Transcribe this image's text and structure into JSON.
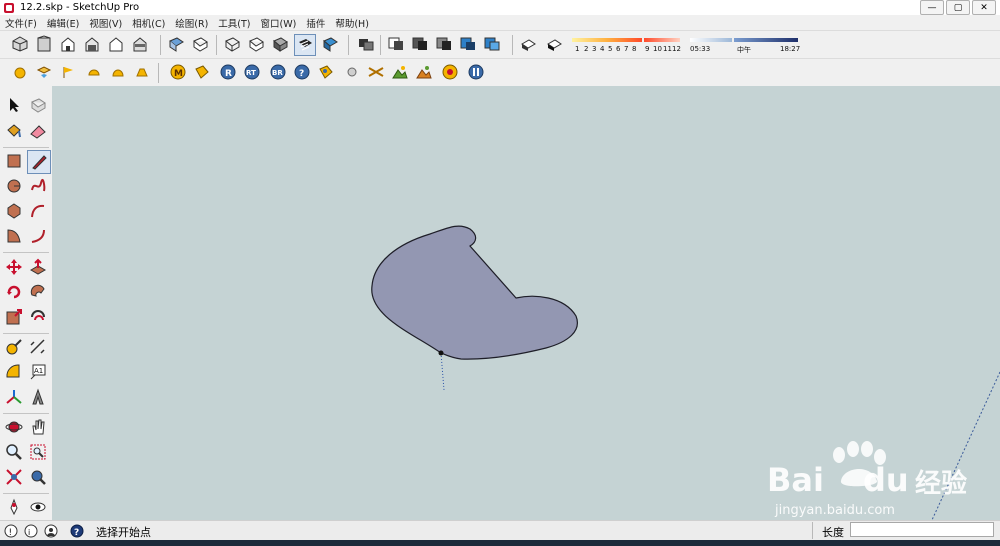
{
  "window": {
    "title": "12.2.skp - SketchUp Pro",
    "minimize": "—",
    "restore": "▢",
    "close": "✕"
  },
  "menu": [
    "文件(F)",
    "编辑(E)",
    "视图(V)",
    "相机(C)",
    "绘图(R)",
    "工具(T)",
    "窗口(W)",
    "插件",
    "帮助(H)"
  ],
  "shadow": {
    "month_ticks": [
      "1",
      "2",
      "3",
      "4",
      "5",
      "6",
      "7",
      "8",
      "9",
      "10",
      "11",
      "12"
    ],
    "time_start": "05:33",
    "time_mid": "中午",
    "time_end": "18:27"
  },
  "status": {
    "hint": "选择开始点",
    "length_label": "长度",
    "length_value": ""
  },
  "watermark": {
    "brand_a": "Bai",
    "brand_b": "du",
    "brand_cn": "经验",
    "url": "jingyan.baidu.com"
  },
  "colors": {
    "viewport": "#c5d3d4",
    "shape_fill": "#9397b2",
    "accent_red": "#c8102e"
  }
}
